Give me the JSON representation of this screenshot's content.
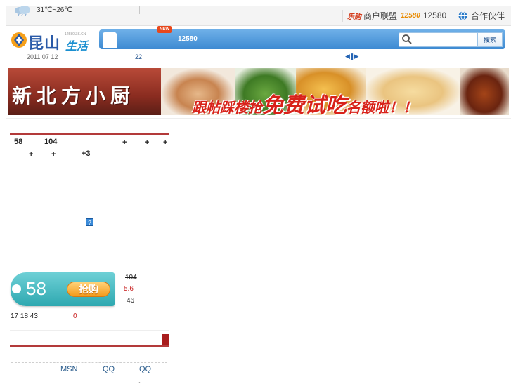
{
  "topbar": {
    "temperature": "31℃~26℃",
    "weather_icon": "cloud-rain-icon",
    "partners": [
      {
        "logo_text": "乐购",
        "label": "商户联盟",
        "icon": "merchant-logo-icon"
      },
      {
        "logo_text": "12580",
        "label": "12580",
        "icon": "12580-logo-icon"
      },
      {
        "logo_text": "",
        "label": "合作伙伴",
        "icon": "partner-globe-icon"
      }
    ]
  },
  "header": {
    "logo_main": "昆山",
    "logo_sub": "生活",
    "logo_url": "12580.ZS.CN",
    "date": "2011 07 12",
    "date_extra": "22",
    "nav_badge": "NEW",
    "nav_item": "12580",
    "search_placeholder": "",
    "search_button": "搜索"
  },
  "banner": {
    "sign_text": "新北方小厨",
    "slogan_1": "跟帖踩楼抢",
    "slogan_2": "免费试吃",
    "slogan_3": "名额啦！！"
  },
  "deal": {
    "price_a": "58",
    "value_b": "104",
    "plus": "+",
    "plus3": "+3",
    "help_icon": "?",
    "tag_price": "58",
    "buy_label": "抢购",
    "original_price": "104",
    "discount": "5.6",
    "saved": "46",
    "countdown": "17 18  43",
    "bought": "0"
  },
  "share": {
    "msn": "MSN",
    "qq1": "QQ",
    "qq2": "QQ",
    "more": "..."
  },
  "colors": {
    "nav_blue": "#3d8ad2",
    "tag_teal": "#2ea8b0",
    "buy_orange": "#f49a1a",
    "accent_red": "#b33a3a"
  }
}
